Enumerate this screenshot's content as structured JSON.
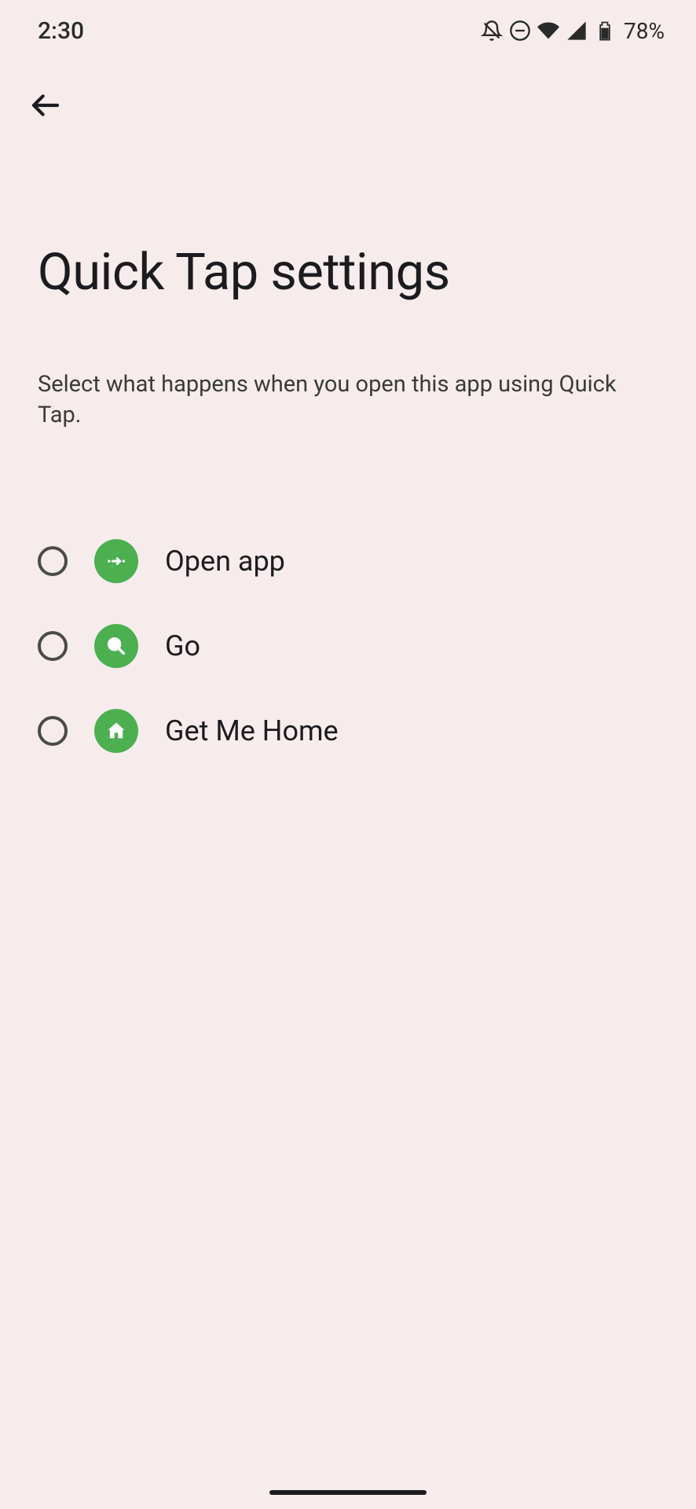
{
  "status_bar": {
    "time": "2:30",
    "battery": "78%"
  },
  "page": {
    "title": "Quick Tap settings",
    "subtitle": "Select what happens when you open this app using Quick Tap."
  },
  "options": [
    {
      "label": "Open app",
      "icon": "arrow-right"
    },
    {
      "label": "Go",
      "icon": "search"
    },
    {
      "label": "Get Me Home",
      "icon": "home"
    }
  ]
}
